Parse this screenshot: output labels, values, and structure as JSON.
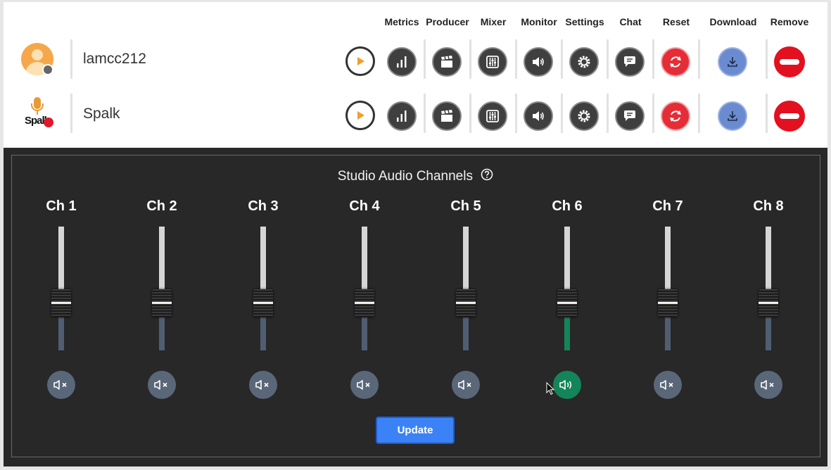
{
  "columns": {
    "metrics": "Metrics",
    "producer": "Producer",
    "mixer": "Mixer",
    "monitor": "Monitor",
    "settings": "Settings",
    "chat": "Chat",
    "reset": "Reset",
    "download": "Download",
    "remove": "Remove"
  },
  "participants": [
    {
      "name": "lamcc212",
      "avatar": "user-avatar-icon",
      "status": "offline"
    },
    {
      "name": "Spalk",
      "avatar": "spalk-logo",
      "logo_text": "Spalk"
    }
  ],
  "mixer": {
    "title": "Studio Audio Channels",
    "channels": [
      {
        "label": "Ch 1",
        "level": 0.38,
        "muted": true
      },
      {
        "label": "Ch 2",
        "level": 0.38,
        "muted": true
      },
      {
        "label": "Ch 3",
        "level": 0.38,
        "muted": true
      },
      {
        "label": "Ch 4",
        "level": 0.38,
        "muted": true
      },
      {
        "label": "Ch 5",
        "level": 0.38,
        "muted": true
      },
      {
        "label": "Ch 6",
        "level": 0.38,
        "muted": false
      },
      {
        "label": "Ch 7",
        "level": 0.38,
        "muted": true
      },
      {
        "label": "Ch 8",
        "level": 0.38,
        "muted": true
      }
    ],
    "update_label": "Update"
  },
  "colors": {
    "active": "#14855a",
    "muted": "#596779",
    "primary": "#3b82f6",
    "danger": "#e3101f"
  }
}
